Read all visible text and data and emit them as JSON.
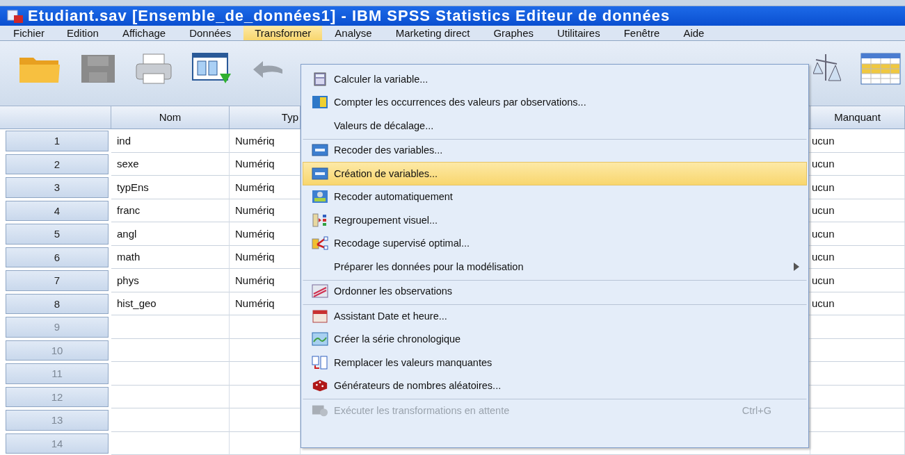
{
  "window": {
    "title": "Etudiant.sav [Ensemble_de_données1] - IBM SPSS Statistics Editeur de données"
  },
  "menu_bar": [
    {
      "label": "Fichier",
      "selected": false
    },
    {
      "label": "Edition",
      "selected": false
    },
    {
      "label": "Affichage",
      "selected": false
    },
    {
      "label": "Données",
      "selected": false
    },
    {
      "label": "Transformer",
      "selected": true
    },
    {
      "label": "Analyse",
      "selected": false
    },
    {
      "label": "Marketing direct",
      "selected": false
    },
    {
      "label": "Graphes",
      "selected": false
    },
    {
      "label": "Utilitaires",
      "selected": false
    },
    {
      "label": "Fenêtre",
      "selected": false
    },
    {
      "label": "Aide",
      "selected": false
    }
  ],
  "grid": {
    "columns": [
      "Nom",
      "Typ",
      "Manquant"
    ],
    "rows": [
      {
        "number": "1",
        "disabled": false,
        "cells": [
          "ind",
          "Numériq",
          "ucun"
        ]
      },
      {
        "number": "2",
        "disabled": false,
        "cells": [
          "sexe",
          "Numériq",
          "ucun"
        ]
      },
      {
        "number": "3",
        "disabled": false,
        "cells": [
          "typEns",
          "Numériq",
          "ucun"
        ]
      },
      {
        "number": "4",
        "disabled": false,
        "cells": [
          "franc",
          "Numériq",
          "ucun"
        ]
      },
      {
        "number": "5",
        "disabled": false,
        "cells": [
          "angl",
          "Numériq",
          "ucun"
        ]
      },
      {
        "number": "6",
        "disabled": false,
        "cells": [
          "math",
          "Numériq",
          "ucun"
        ]
      },
      {
        "number": "7",
        "disabled": false,
        "cells": [
          "phys",
          "Numériq",
          "ucun"
        ]
      },
      {
        "number": "8",
        "disabled": false,
        "cells": [
          "hist_geo",
          "Numériq",
          "ucun"
        ]
      },
      {
        "number": "9",
        "disabled": true,
        "cells": []
      },
      {
        "number": "10",
        "disabled": true,
        "cells": []
      },
      {
        "number": "11",
        "disabled": true,
        "cells": []
      },
      {
        "number": "12",
        "disabled": true,
        "cells": []
      },
      {
        "number": "13",
        "disabled": true,
        "cells": []
      },
      {
        "number": "14",
        "disabled": true,
        "cells": []
      }
    ]
  },
  "transform_menu": {
    "items": [
      {
        "label": "Calculer la variable...",
        "selected": false,
        "disabled": false,
        "separator_before": false
      },
      {
        "label": "Compter les occurrences des valeurs par observations...",
        "selected": false,
        "disabled": false,
        "separator_before": false
      },
      {
        "label": "Valeurs de décalage...",
        "selected": false,
        "disabled": false,
        "separator_before": false
      },
      {
        "label": "Recoder des variables...",
        "selected": false,
        "disabled": false,
        "separator_before": true
      },
      {
        "label": "Création de variables...",
        "selected": true,
        "disabled": false,
        "separator_before": false
      },
      {
        "label": "Recoder automatiquement",
        "selected": false,
        "disabled": false,
        "separator_before": false
      },
      {
        "label": "Regroupement visuel...",
        "selected": false,
        "disabled": false,
        "separator_before": false
      },
      {
        "label": "Recodage supervisé optimal...",
        "selected": false,
        "disabled": false,
        "separator_before": false
      },
      {
        "label": "Préparer les données pour la modélisation",
        "selected": false,
        "disabled": false,
        "separator_before": false,
        "submenu": true
      },
      {
        "label": "Ordonner les observations",
        "selected": false,
        "disabled": false,
        "separator_before": true
      },
      {
        "label": "Assistant Date et heure...",
        "selected": false,
        "disabled": false,
        "separator_before": true
      },
      {
        "label": "Créer la série chronologique",
        "selected": false,
        "disabled": false,
        "separator_before": false
      },
      {
        "label": "Remplacer les valeurs manquantes",
        "selected": false,
        "disabled": false,
        "separator_before": false
      },
      {
        "label": "Générateurs de nombres aléatoires...",
        "selected": false,
        "disabled": false,
        "separator_before": false
      },
      {
        "label": "Exécuter les transformations en attente",
        "selected": false,
        "disabled": true,
        "separator_before": true,
        "shortcut": "Ctrl+G"
      }
    ]
  }
}
